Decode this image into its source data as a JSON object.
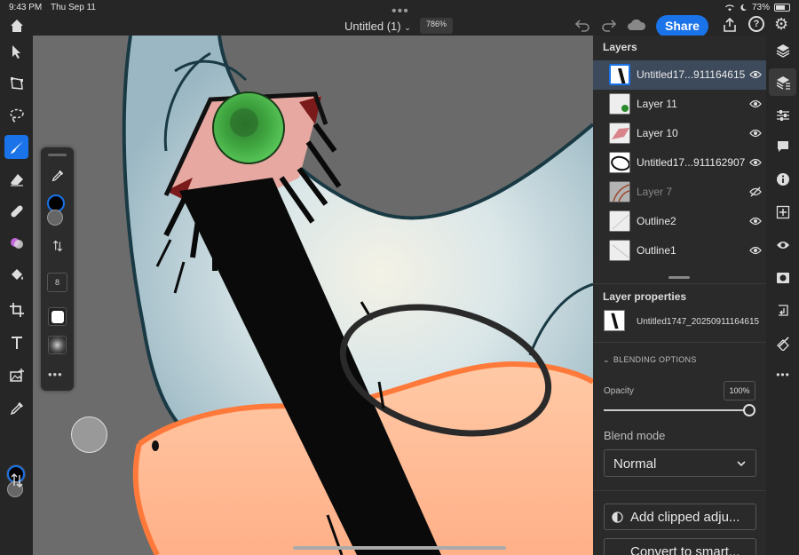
{
  "status_bar": {
    "time": "9:43 PM",
    "date": "Thu Sep 11",
    "battery": "73%",
    "battery_level": 0.73
  },
  "header": {
    "title": "Untitled (1)",
    "zoom": "786%",
    "share_label": "Share"
  },
  "brush_bar": {
    "size": "8"
  },
  "panel": {
    "title": "Layers",
    "layers": [
      {
        "name": "Untitled17...911164615",
        "selected": true,
        "visible": true
      },
      {
        "name": "Layer 11",
        "selected": false,
        "visible": true
      },
      {
        "name": "Layer 10",
        "selected": false,
        "visible": true
      },
      {
        "name": "Untitled17...911162907",
        "selected": false,
        "visible": true
      },
      {
        "name": "Layer 7",
        "selected": false,
        "visible": false
      },
      {
        "name": "Outline2",
        "selected": false,
        "visible": true
      },
      {
        "name": "Outline1",
        "selected": false,
        "visible": true
      }
    ],
    "properties_title": "Layer properties",
    "properties_name": "Untitled1747_20250911164615",
    "blending_header": "BLENDING OPTIONS",
    "opacity_label": "Opacity",
    "opacity_value": "100%",
    "opacity_level": 1.0,
    "blend_mode_label": "Blend mode",
    "blend_mode": "Normal",
    "add_clipped_label": "Add clipped adju...",
    "convert_smart_label": "Convert to smart..."
  },
  "colors": {
    "accent": "#1a73e8",
    "foreground": "#000000",
    "background": "#666666"
  }
}
